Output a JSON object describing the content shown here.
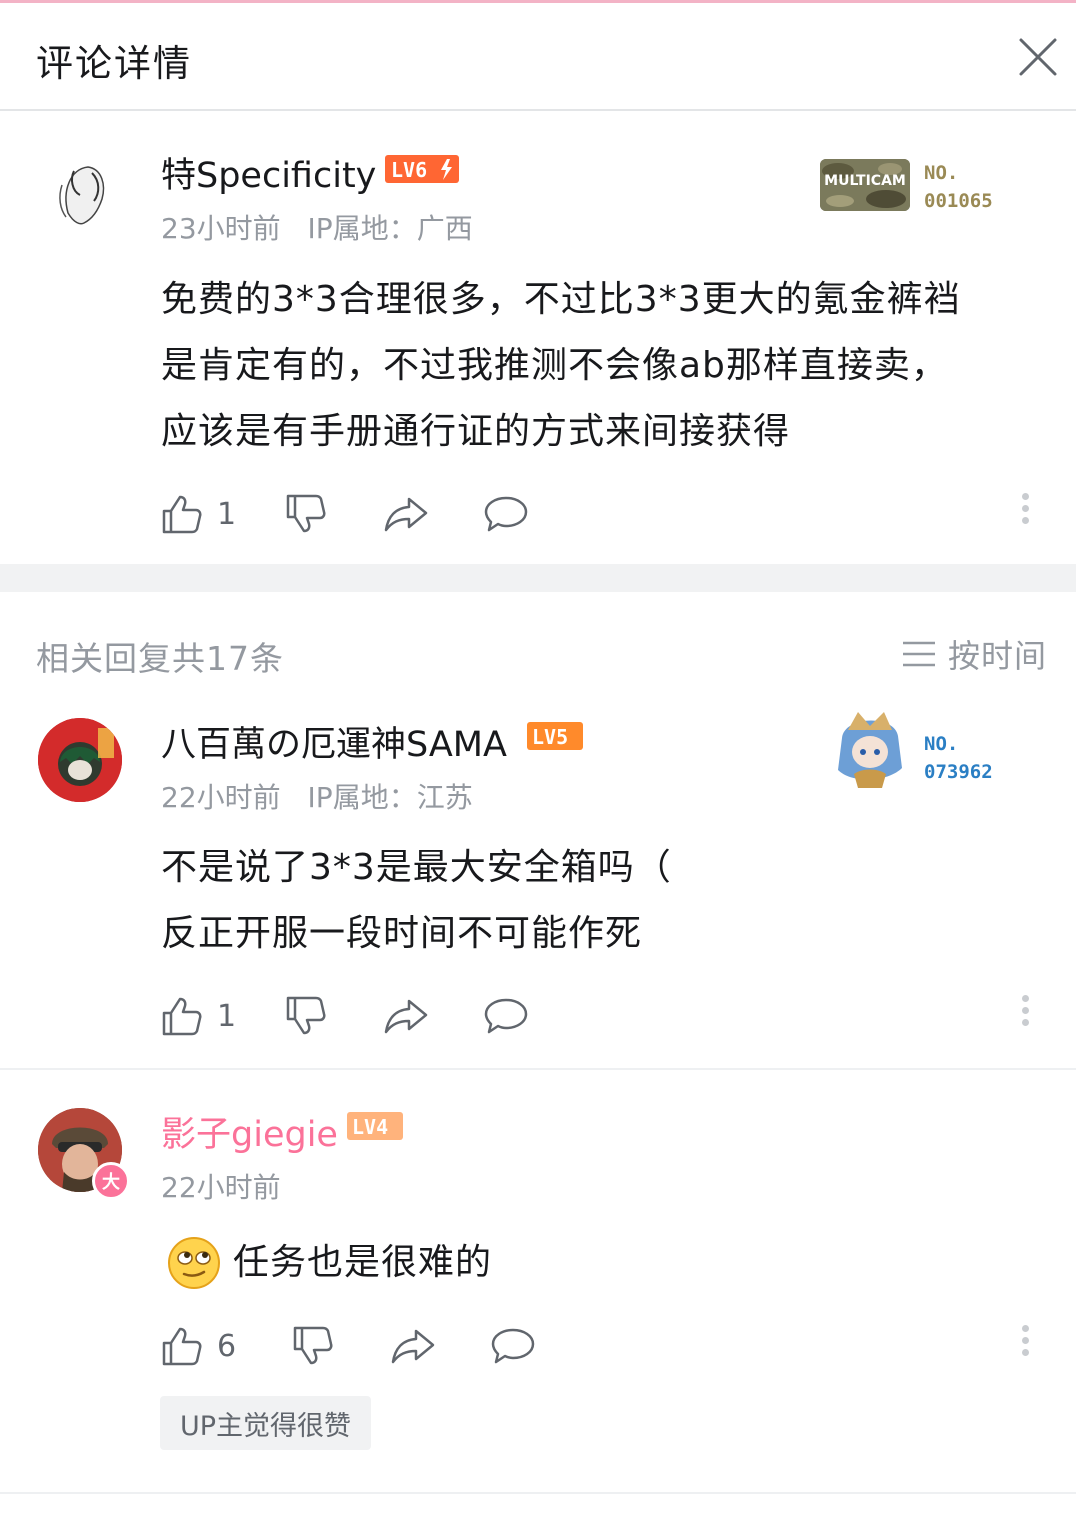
{
  "header": {
    "title": "评论详情"
  },
  "main_comment": {
    "username": "特Specificity",
    "level": "LV6",
    "time": "23小时前",
    "ip": "IP属地：广西",
    "badge": {
      "label": "MULTICAM",
      "no_label": "NO.",
      "number": "001065"
    },
    "text_lines": [
      "免费的3*3合理很多，不过比3*3更大的氪金裤裆",
      "是肯定有的，不过我推测不会像ab那样直接卖，",
      "应该是有手册通行证的方式来间接获得"
    ],
    "likes": "1"
  },
  "replies_section": {
    "title": "相关回复共17条",
    "sort_label": "按时间"
  },
  "replies": [
    {
      "username": "八百萬の厄運神SAMA",
      "level": "LV5",
      "time": "22小时前",
      "ip": "IP属地：江苏",
      "badge": {
        "no_label": "NO.",
        "number": "073962"
      },
      "text_lines": [
        "不是说了3*3是最大安全箱吗（",
        "反正开服一段时间不可能作死"
      ],
      "likes": "1"
    },
    {
      "username": "影子giegie",
      "level": "LV4",
      "time": "22小时前",
      "text_lines": [
        "任务也是很难的"
      ],
      "likes": "6",
      "up_tag": "UP主觉得很赞",
      "vip_mark": "大"
    }
  ],
  "colors": {
    "accent_pink": "#fb7299",
    "level_orange": "#ff6633",
    "text_gray": "#9499a0"
  }
}
